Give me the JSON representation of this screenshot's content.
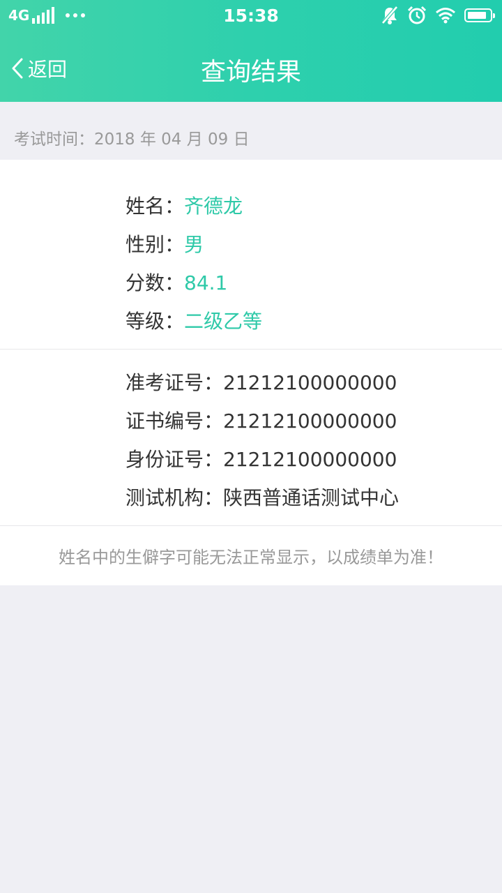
{
  "status_bar": {
    "carrier": "4G",
    "time": "15:38",
    "battery_level": 0.85,
    "icons": [
      "signal-icon",
      "more-dots-icon",
      "mute-bell-icon",
      "alarm-icon",
      "wifi-icon",
      "battery-icon"
    ]
  },
  "nav": {
    "back_label": "返回",
    "title": "查询结果"
  },
  "exam": {
    "date_label": "考试时间：",
    "date_value": "2018 年 04 月 09 日"
  },
  "result": {
    "name_label": "姓名：",
    "name_value": "齐德龙",
    "gender_label": "性别：",
    "gender_value": "男",
    "score_label": "分数：",
    "score_value": "84.1",
    "level_label": "等级：",
    "level_value": "二级乙等"
  },
  "ids": {
    "admission_label": "准考证号：",
    "admission_value": "21212100000000",
    "certificate_label": "证书编号：",
    "certificate_value": "21212100000000",
    "idcard_label": "身份证号：",
    "idcard_value": "21212100000000",
    "agency_label": "测试机构：",
    "agency_value": "陕西普通话测试中心"
  },
  "notice": "姓名中的生僻字可能无法正常显示，以成绩单为准！",
  "colors": {
    "header_start": "#42d4aa",
    "header_end": "#22cdae",
    "accent_text": "#2ec9a8",
    "background": "#efeff4"
  }
}
